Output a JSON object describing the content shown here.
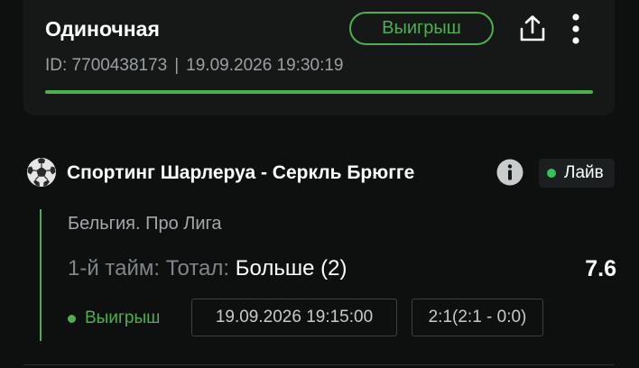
{
  "bet": {
    "type": "Одиночная",
    "id": "ID: 7700438173",
    "separator": "|",
    "datetime": "19.09.2026 19:30:19",
    "status": "Выигрыш",
    "progress": 1.0,
    "share_icon": "share-icon",
    "more_icon": "more-vertical-icon"
  },
  "event": {
    "sport_icon": "soccer-ball-icon",
    "title": "Спортинг Шарлеруа - Серкль Брюгге",
    "info_icon": "info-icon",
    "live_label": "Лайв",
    "league": "Бельгия. Про Лига",
    "market_label": "1-й тайм: Тотал:",
    "market_pick": "Больше (2)",
    "odds": "7.6",
    "result_status": "Выигрыш",
    "start_time": "19.09.2026 19:15:00",
    "score": "2:1(2:1 - 0:0)"
  },
  "colors": {
    "background": "#0e0f0f",
    "card": "#161818",
    "win_green": "#4caf50",
    "live_green": "#35c25a",
    "muted_text": "#9aa0a2"
  }
}
